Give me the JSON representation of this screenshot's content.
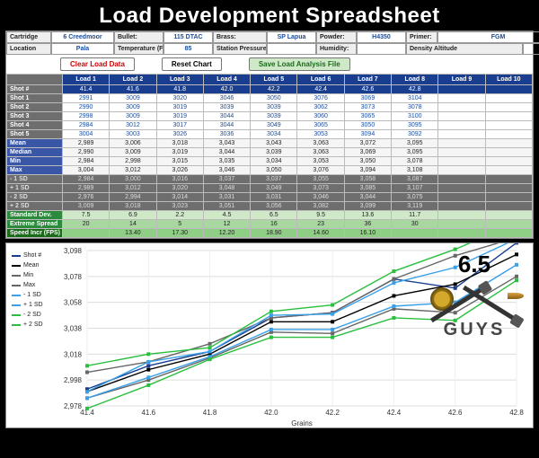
{
  "title": "Load Development Spreadsheet",
  "meta": {
    "cartridge_lbl": "Cartridge",
    "cartridge": "6 Creedmoor",
    "bullet_lbl": "Bullet:",
    "bullet": "115 DTAC",
    "brass_lbl": "Brass:",
    "brass": "SP Lapua",
    "powder_lbl": "Powder:",
    "powder": "H4350",
    "primer_lbl": "Primer:",
    "primer": "FGM",
    "location_lbl": "Location",
    "location": "Pala",
    "temp_lbl": "Temperature (F):",
    "temp": "85",
    "press_lbl": "Station Pressure:",
    "press": "",
    "humid_lbl": "Humidity:",
    "humid": "",
    "da_lbl": "Density Altitude",
    "da": ""
  },
  "buttons": {
    "clear": "Clear Load Data",
    "reset": "Reset Chart",
    "save": "Save Load Analysis File"
  },
  "loads": [
    "Load 1",
    "Load 2",
    "Load 3",
    "Load 4",
    "Load 5",
    "Load 6",
    "Load 7",
    "Load 8",
    "Load 9",
    "Load 10"
  ],
  "load_vals": [
    "41.4",
    "41.6",
    "41.8",
    "42.0",
    "42.2",
    "42.4",
    "42.6",
    "42.8",
    "",
    ""
  ],
  "row_labels": {
    "shotnum": "Shot #",
    "s1": "Shot 1",
    "s2": "Shot 2",
    "s3": "Shot 3",
    "s4": "Shot 4",
    "s5": "Shot 5",
    "mean": "Mean",
    "median": "Median",
    "min": "Min",
    "max": "Max",
    "m1sd": "- 1 SD",
    "p1sd": "+ 1 SD",
    "m2sd": "- 2 SD",
    "p2sd": "+ 2 SD",
    "sd": "Standard Dev.",
    "es": "Extreme Spread",
    "sp": "Speed Incr (FPS)"
  },
  "shots": {
    "s1": [
      "2991",
      "3009",
      "3020",
      "3046",
      "3050",
      "3076",
      "3069",
      "3104",
      "",
      ""
    ],
    "s2": [
      "2990",
      "3009",
      "3019",
      "3039",
      "3039",
      "3062",
      "3073",
      "3078",
      "",
      ""
    ],
    "s3": [
      "2998",
      "3009",
      "3019",
      "3044",
      "3039",
      "3060",
      "3065",
      "3100",
      "",
      ""
    ],
    "s4": [
      "2984",
      "3012",
      "3017",
      "3044",
      "3049",
      "3065",
      "3050",
      "3095",
      "",
      ""
    ],
    "s5": [
      "3004",
      "3003",
      "3026",
      "3036",
      "3034",
      "3053",
      "3094",
      "3092",
      "",
      ""
    ]
  },
  "stats": {
    "mean": [
      "2,989",
      "3,006",
      "3,018",
      "3,043",
      "3,043",
      "3,063",
      "3,072",
      "3,095",
      "",
      ""
    ],
    "median": [
      "2,990",
      "3,009",
      "3,019",
      "3,044",
      "3,039",
      "3,063",
      "3,069",
      "3,095",
      "",
      ""
    ],
    "min": [
      "2,984",
      "2,998",
      "3,015",
      "3,035",
      "3,034",
      "3,053",
      "3,050",
      "3,078",
      "",
      ""
    ],
    "max": [
      "3,004",
      "3,012",
      "3,026",
      "3,046",
      "3,050",
      "3,076",
      "3,094",
      "3,108",
      "",
      ""
    ],
    "m1sd": [
      "2,984",
      "3,000",
      "3,016",
      "3,037",
      "3,037",
      "3,055",
      "3,058",
      "3,087",
      "",
      ""
    ],
    "p1sd": [
      "2,989",
      "3,012",
      "3,020",
      "3,048",
      "3,049",
      "3,073",
      "3,085",
      "3,107",
      "",
      ""
    ],
    "m2sd": [
      "2,976",
      "2,994",
      "3,014",
      "3,031",
      "3,031",
      "3,046",
      "3,044",
      "3,075",
      "",
      ""
    ],
    "p2sd": [
      "3,009",
      "3,018",
      "3,023",
      "3,051",
      "3,056",
      "3,082",
      "3,099",
      "3,119",
      "",
      ""
    ],
    "sd": [
      "7.5",
      "6.9",
      "2.2",
      "4.5",
      "6.5",
      "9.5",
      "13.6",
      "11.7",
      "",
      ""
    ],
    "es": [
      "20",
      "14",
      "5",
      "12",
      "16",
      "23",
      "36",
      "30",
      "",
      ""
    ],
    "sp": [
      "",
      "13.40",
      "17.30",
      "12.20",
      "18.90",
      "14.60",
      "16.10",
      "",
      "",
      ""
    ]
  },
  "chart_data": {
    "type": "line",
    "title": "",
    "xlabel": "Grains",
    "ylabel": "",
    "x": [
      41.4,
      41.6,
      41.8,
      42.0,
      42.2,
      42.4,
      42.6,
      42.8
    ],
    "ylim": [
      2978,
      3098
    ],
    "yticks": [
      2978,
      2998,
      3018,
      3038,
      3058,
      3078,
      3098
    ],
    "series": [
      {
        "name": "Shot #",
        "color": "#1a3e8f",
        "values": [
          2991,
          3009,
          3020,
          3046,
          3050,
          3076,
          3069,
          3104
        ]
      },
      {
        "name": "Mean",
        "color": "#000000",
        "values": [
          2989,
          3006,
          3018,
          3043,
          3043,
          3063,
          3072,
          3095
        ]
      },
      {
        "name": "Min",
        "color": "#666666",
        "values": [
          2984,
          2998,
          3015,
          3035,
          3034,
          3053,
          3050,
          3078
        ]
      },
      {
        "name": "Max",
        "color": "#666666",
        "values": [
          3004,
          3012,
          3026,
          3046,
          3050,
          3076,
          3094,
          3108
        ]
      },
      {
        "name": "- 1 SD",
        "color": "#3aa0e8",
        "values": [
          2984,
          3000,
          3016,
          3037,
          3037,
          3055,
          3058,
          3087
        ]
      },
      {
        "name": "+ 1 SD",
        "color": "#3aa0e8",
        "values": [
          2989,
          3012,
          3020,
          3048,
          3049,
          3073,
          3085,
          3107
        ]
      },
      {
        "name": "- 2 SD",
        "color": "#2bbf3f",
        "values": [
          2976,
          2994,
          3014,
          3031,
          3031,
          3046,
          3044,
          3075
        ]
      },
      {
        "name": "+ 2 SD",
        "color": "#2bbf3f",
        "values": [
          3009,
          3018,
          3023,
          3051,
          3056,
          3082,
          3099,
          3119
        ]
      }
    ]
  },
  "logo": {
    "top": "6.5",
    "bottom": "GUYS"
  }
}
